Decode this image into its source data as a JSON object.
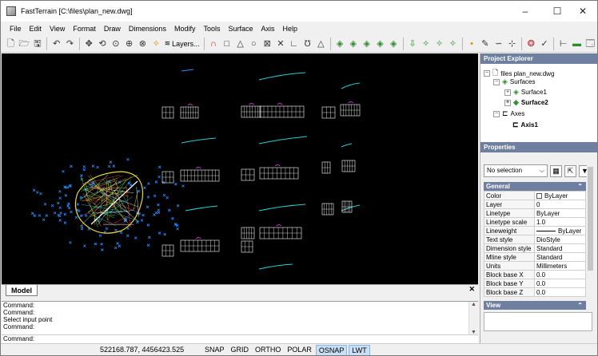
{
  "window": {
    "title": "FastTerrain [C:\\files\\plan_new.dwg]",
    "min_glyph": "–",
    "max_glyph": "☐",
    "close_glyph": "✕"
  },
  "menu": [
    "File",
    "Edit",
    "View",
    "Format",
    "Draw",
    "Dimensions",
    "Modify",
    "Tools",
    "Surface",
    "Axis",
    "Help"
  ],
  "toolbar": {
    "layers_label": "Layers..."
  },
  "canvas": {
    "tab_label": "Model",
    "close_glyph": "✕",
    "background": "#000000",
    "accent_colors": [
      "#2b8cff",
      "#e9d83a",
      "#25d0d0",
      "#ff3cff"
    ]
  },
  "command": {
    "history": [
      "Command:",
      "Command:",
      "Select input point",
      "Command:"
    ],
    "prompt": "Command:"
  },
  "status": {
    "coordinates": "522168.787, 4456423.525",
    "toggles": [
      {
        "label": "SNAP",
        "active": false
      },
      {
        "label": "GRID",
        "active": false
      },
      {
        "label": "ORTHO",
        "active": false
      },
      {
        "label": "POLAR",
        "active": false
      },
      {
        "label": "OSNAP",
        "active": true
      },
      {
        "label": "LWT",
        "active": true
      }
    ]
  },
  "explorer": {
    "title": "Project Explorer",
    "nodes": [
      {
        "label": "files plan_new.dwg",
        "bold": false,
        "toggle": "−",
        "icon": "file-icon"
      },
      {
        "label": "Surfaces",
        "bold": false,
        "toggle": "−",
        "icon": "surface-icon"
      },
      {
        "label": "Surface1",
        "bold": false,
        "toggle": "+",
        "icon": "surface-icon"
      },
      {
        "label": "Surface2",
        "bold": true,
        "toggle": "+",
        "icon": "surface-icon"
      },
      {
        "label": "Axes",
        "bold": false,
        "toggle": "−",
        "icon": "axis-icon"
      },
      {
        "label": "Axis1",
        "bold": true,
        "toggle": "",
        "icon": "axis-icon"
      }
    ]
  },
  "properties": {
    "title": "Properties",
    "selection": "No selection",
    "section_general": "General",
    "section_view": "View",
    "collapse_glyph": "⌃",
    "rows": [
      {
        "key": "Color",
        "value": "ByLayer"
      },
      {
        "key": "Layer",
        "value": "0"
      },
      {
        "key": "Linetype",
        "value": "ByLayer"
      },
      {
        "key": "Linetype scale",
        "value": "1.0"
      },
      {
        "key": "Lineweight",
        "value": "ByLayer"
      },
      {
        "key": "Text style",
        "value": "DioStyle"
      },
      {
        "key": "Dimension style",
        "value": "Standard"
      },
      {
        "key": "Mline style",
        "value": "Standard"
      },
      {
        "key": "Units",
        "value": "Millimeters"
      },
      {
        "key": "Block base X",
        "value": "0.0"
      },
      {
        "key": "Block base Y",
        "value": "0.0"
      },
      {
        "key": "Block base Z",
        "value": "0.0"
      }
    ]
  }
}
